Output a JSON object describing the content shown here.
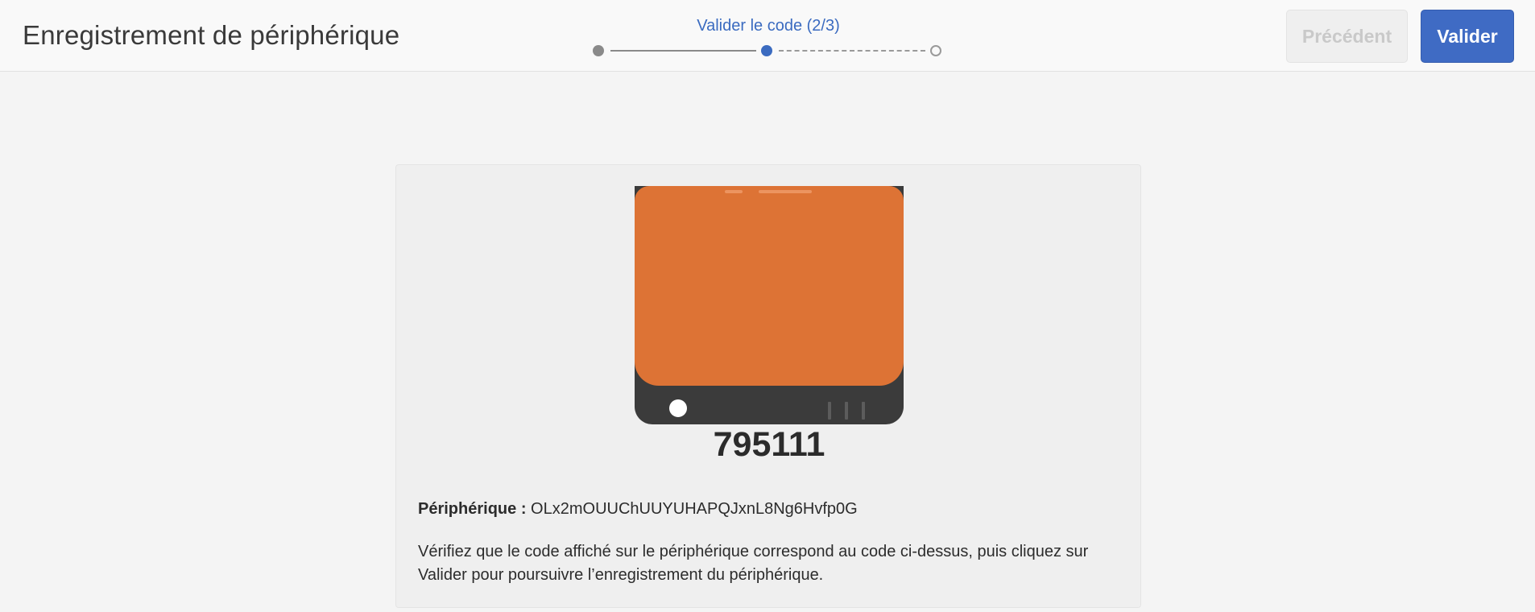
{
  "header": {
    "title": "Enregistrement de périphérique",
    "stepper": {
      "label": "Valider le code (2/3)",
      "current_step": 2,
      "total_steps": 3
    },
    "prev_label": "Précédent",
    "validate_label": "Valider"
  },
  "card": {
    "code": "795111",
    "device_label": "Périphérique :",
    "device_id": "OLx2mOUUChUUYUHAPQJxnL8Ng6Hvfp0G",
    "instructions": "Vérifiez que le code affiché sur le périphérique correspond au code ci-dessus, puis cliquez sur Valider pour poursuivre l’enregistrement du périphérique."
  },
  "colors": {
    "accent": "#3f6bc4",
    "screen": "#dd7335",
    "device_body": "#3b3b3b"
  }
}
